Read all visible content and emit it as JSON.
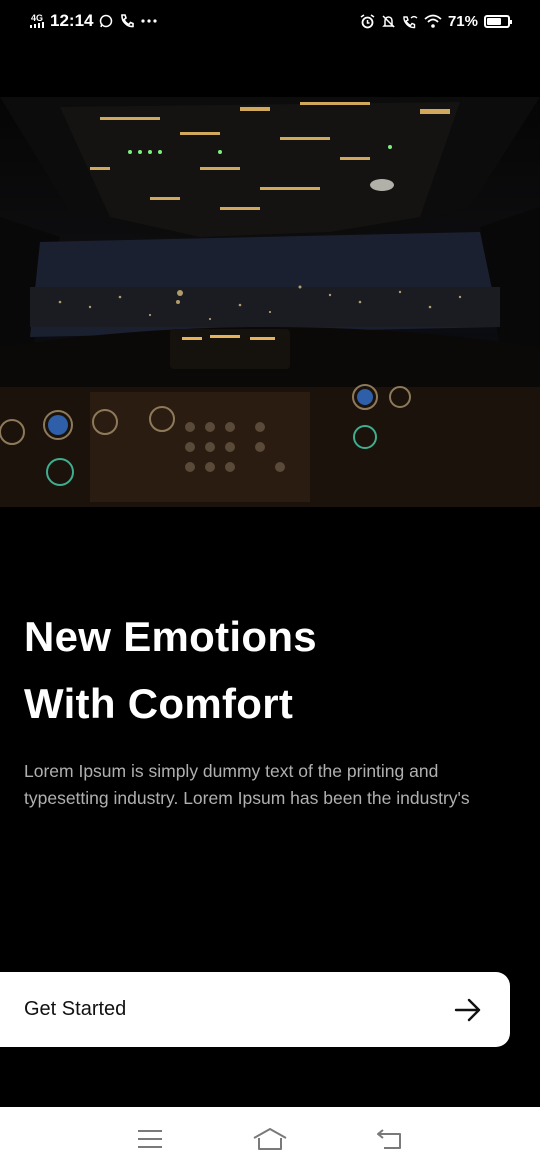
{
  "status_bar": {
    "network": "4G",
    "time": "12:14",
    "battery_percent": "71%",
    "battery_level": 0.71,
    "icons": [
      "whatsapp-icon",
      "call-icon",
      "more-icon",
      "alarm-icon",
      "mute-icon",
      "wifi-calling-icon",
      "wifi-icon",
      "battery-icon"
    ]
  },
  "hero": {
    "image_subject": "airplane-cockpit-at-night"
  },
  "main": {
    "headline_line1": "New Emotions",
    "headline_line2": "With Comfort",
    "description": "Lorem Ipsum is simply dummy text of the printing and typesetting industry. Lorem Ipsum has been the industry's"
  },
  "cta": {
    "label": "Get Started",
    "icon": "arrow-right-icon"
  },
  "nav_bar": {
    "icons": [
      "menu-icon",
      "home-icon",
      "back-icon"
    ]
  },
  "colors": {
    "background": "#000000",
    "text_primary": "#ffffff",
    "text_secondary": "#b0b0b0",
    "button_bg": "#ffffff",
    "button_text": "#111111"
  }
}
